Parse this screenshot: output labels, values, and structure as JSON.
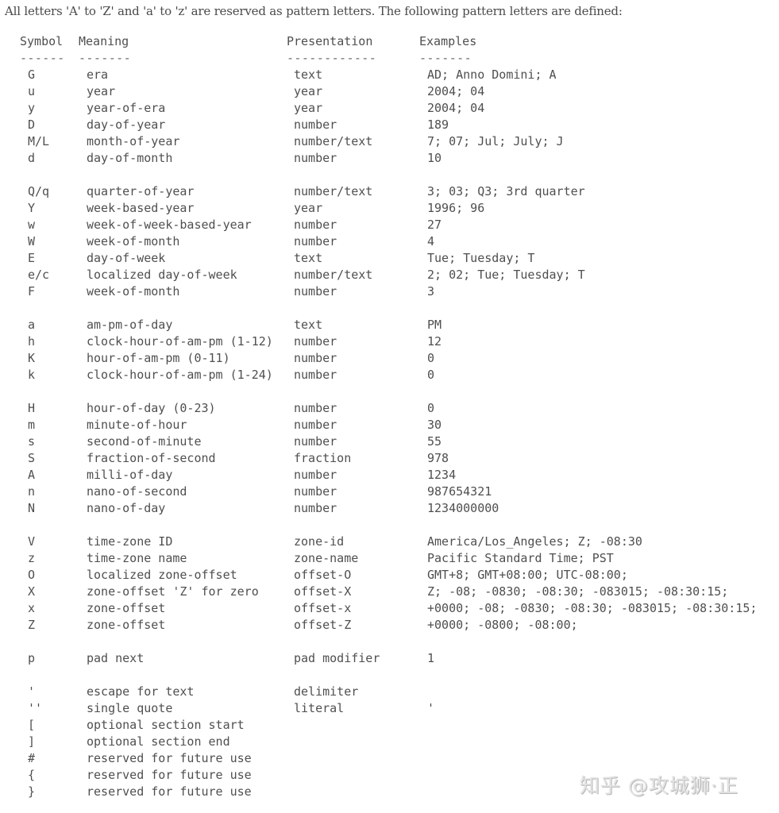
{
  "intro_text": "All letters 'A' to 'Z' and 'a' to 'z' are reserved as pattern letters. The following pattern letters are defined:",
  "table": {
    "headers": {
      "symbol": "Symbol",
      "meaning": "Meaning",
      "presentation": "Presentation",
      "examples": "Examples"
    },
    "separators": {
      "symbol": "------",
      "meaning": "-------",
      "presentation": "------------",
      "examples": "-------"
    },
    "groups": [
      [
        {
          "symbol": "G",
          "meaning": "era",
          "presentation": "text",
          "examples": "AD; Anno Domini; A"
        },
        {
          "symbol": "u",
          "meaning": "year",
          "presentation": "year",
          "examples": "2004; 04"
        },
        {
          "symbol": "y",
          "meaning": "year-of-era",
          "presentation": "year",
          "examples": "2004; 04"
        },
        {
          "symbol": "D",
          "meaning": "day-of-year",
          "presentation": "number",
          "examples": "189"
        },
        {
          "symbol": "M/L",
          "meaning": "month-of-year",
          "presentation": "number/text",
          "examples": "7; 07; Jul; July; J"
        },
        {
          "symbol": "d",
          "meaning": "day-of-month",
          "presentation": "number",
          "examples": "10"
        }
      ],
      [
        {
          "symbol": "Q/q",
          "meaning": "quarter-of-year",
          "presentation": "number/text",
          "examples": "3; 03; Q3; 3rd quarter"
        },
        {
          "symbol": "Y",
          "meaning": "week-based-year",
          "presentation": "year",
          "examples": "1996; 96"
        },
        {
          "symbol": "w",
          "meaning": "week-of-week-based-year",
          "presentation": "number",
          "examples": "27"
        },
        {
          "symbol": "W",
          "meaning": "week-of-month",
          "presentation": "number",
          "examples": "4"
        },
        {
          "symbol": "E",
          "meaning": "day-of-week",
          "presentation": "text",
          "examples": "Tue; Tuesday; T"
        },
        {
          "symbol": "e/c",
          "meaning": "localized day-of-week",
          "presentation": "number/text",
          "examples": "2; 02; Tue; Tuesday; T"
        },
        {
          "symbol": "F",
          "meaning": "week-of-month",
          "presentation": "number",
          "examples": "3"
        }
      ],
      [
        {
          "symbol": "a",
          "meaning": "am-pm-of-day",
          "presentation": "text",
          "examples": "PM"
        },
        {
          "symbol": "h",
          "meaning": "clock-hour-of-am-pm (1-12)",
          "presentation": "number",
          "examples": "12"
        },
        {
          "symbol": "K",
          "meaning": "hour-of-am-pm (0-11)",
          "presentation": "number",
          "examples": "0"
        },
        {
          "symbol": "k",
          "meaning": "clock-hour-of-am-pm (1-24)",
          "presentation": "number",
          "examples": "0"
        }
      ],
      [
        {
          "symbol": "H",
          "meaning": "hour-of-day (0-23)",
          "presentation": "number",
          "examples": "0"
        },
        {
          "symbol": "m",
          "meaning": "minute-of-hour",
          "presentation": "number",
          "examples": "30"
        },
        {
          "symbol": "s",
          "meaning": "second-of-minute",
          "presentation": "number",
          "examples": "55"
        },
        {
          "symbol": "S",
          "meaning": "fraction-of-second",
          "presentation": "fraction",
          "examples": "978"
        },
        {
          "symbol": "A",
          "meaning": "milli-of-day",
          "presentation": "number",
          "examples": "1234"
        },
        {
          "symbol": "n",
          "meaning": "nano-of-second",
          "presentation": "number",
          "examples": "987654321"
        },
        {
          "symbol": "N",
          "meaning": "nano-of-day",
          "presentation": "number",
          "examples": "1234000000"
        }
      ],
      [
        {
          "symbol": "V",
          "meaning": "time-zone ID",
          "presentation": "zone-id",
          "examples": "America/Los_Angeles; Z; -08:30"
        },
        {
          "symbol": "z",
          "meaning": "time-zone name",
          "presentation": "zone-name",
          "examples": "Pacific Standard Time; PST"
        },
        {
          "symbol": "O",
          "meaning": "localized zone-offset",
          "presentation": "offset-O",
          "examples": "GMT+8; GMT+08:00; UTC-08:00;"
        },
        {
          "symbol": "X",
          "meaning": "zone-offset 'Z' for zero",
          "presentation": "offset-X",
          "examples": "Z; -08; -0830; -08:30; -083015; -08:30:15;"
        },
        {
          "symbol": "x",
          "meaning": "zone-offset",
          "presentation": "offset-x",
          "examples": "+0000; -08; -0830; -08:30; -083015; -08:30:15;"
        },
        {
          "symbol": "Z",
          "meaning": "zone-offset",
          "presentation": "offset-Z",
          "examples": "+0000; -0800; -08:00;"
        }
      ],
      [
        {
          "symbol": "p",
          "meaning": "pad next",
          "presentation": "pad modifier",
          "examples": "1"
        }
      ],
      [
        {
          "symbol": "'",
          "meaning": "escape for text",
          "presentation": "delimiter",
          "examples": ""
        },
        {
          "symbol": "''",
          "meaning": "single quote",
          "presentation": "literal",
          "examples": "'"
        },
        {
          "symbol": "[",
          "meaning": "optional section start",
          "presentation": "",
          "examples": ""
        },
        {
          "symbol": "]",
          "meaning": "optional section end",
          "presentation": "",
          "examples": ""
        },
        {
          "symbol": "#",
          "meaning": "reserved for future use",
          "presentation": "",
          "examples": ""
        },
        {
          "symbol": "{",
          "meaning": "reserved for future use",
          "presentation": "",
          "examples": ""
        },
        {
          "symbol": "}",
          "meaning": "reserved for future use",
          "presentation": "",
          "examples": ""
        }
      ]
    ]
  },
  "watermark": "知乎 @攻城狮·正"
}
